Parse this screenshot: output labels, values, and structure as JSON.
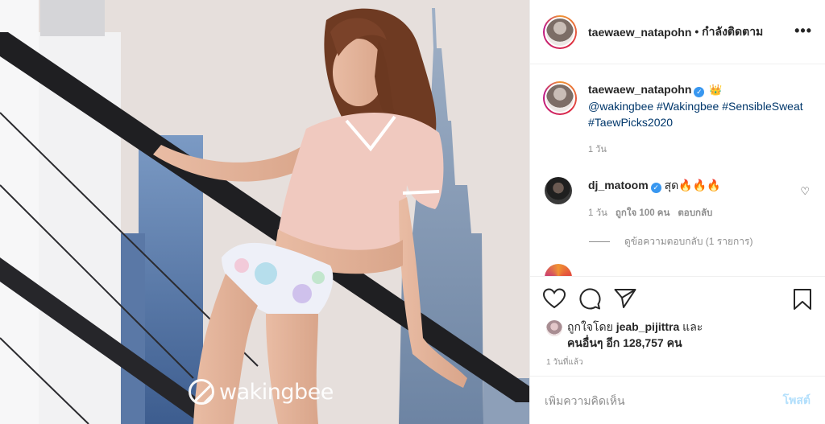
{
  "photo": {
    "watermark": "wakingbee",
    "logo_icon": "wakingbee-logo-icon"
  },
  "header": {
    "username": "taewaew_natapohn",
    "follow_status": "• กำลังติดตาม",
    "more_icon": "more-options-icon",
    "more_glyph": "•••"
  },
  "caption": {
    "username": "taewaew_natapohn",
    "verified_glyph": "✓",
    "crown_glyph": "👑",
    "text": "@wakingbee #Wakingbee #SensibleSweat #TaewPicks2020",
    "time": "1 วัน"
  },
  "comment": {
    "username": "dj_matoom",
    "verified_glyph": "✓",
    "text": "สุด🔥🔥🔥",
    "time": "1 วัน",
    "likes": "ถูกใจ 100 คน",
    "reply_label": "ตอบกลับ",
    "heart_glyph": "♡",
    "view_replies": "ดูข้อความตอบกลับ (1 รายการ)"
  },
  "actions": {
    "like_icon": "heart-icon",
    "comment_icon": "comment-icon",
    "share_icon": "share-icon",
    "save_icon": "bookmark-icon"
  },
  "likes": {
    "prefix": "ถูกใจโดย ",
    "liker": "jeab_pijittra",
    "joiner": " และ",
    "others": "คนอื่นๆ อีก 128,757 คน"
  },
  "posted_ago": "1 วันที่แล้ว",
  "add_comment": {
    "placeholder": "เพิ่มความคิดเห็น",
    "post_label": "โพสต์"
  }
}
